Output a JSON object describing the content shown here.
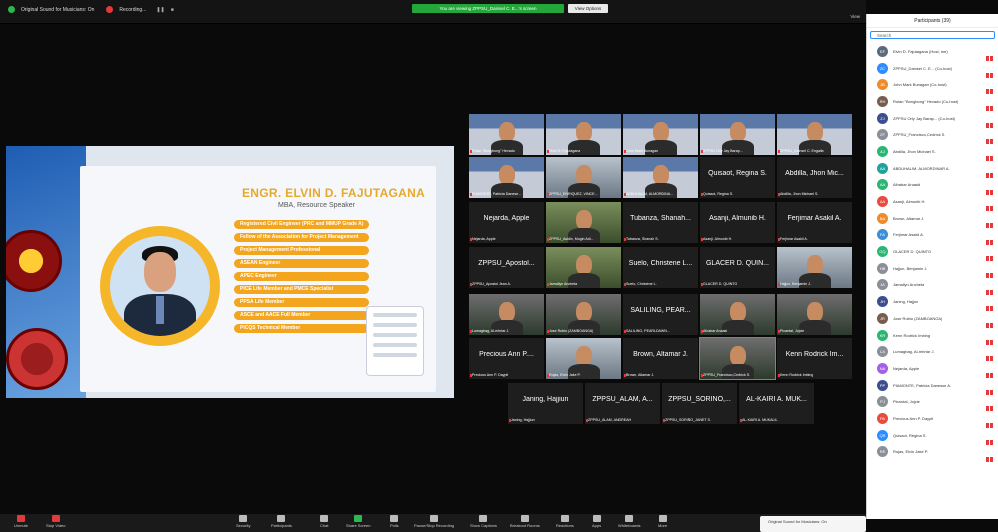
{
  "topbar": {
    "audio_label": "Original Sound for Musicians: On",
    "recording_label": "Recording...",
    "share_notice": "You are viewing ZPPSU_Dainsel C. E...'s screen",
    "view_options": "View Options",
    "view_button": "View"
  },
  "slide": {
    "speaker_name": "ENGR. ELVIN D. FAJUTAGANA",
    "speaker_sub": "MBA, Resource Speaker",
    "credentials": [
      "Registered Civil Engineer (PRC and MMUP Grade A)",
      "Fellow of the Association for Project Management",
      "Project Management Professional",
      "ASEAN Engineer",
      "APEC Engineer",
      "PICE Life Member and PMCE Specialist",
      "PPSA Life Member",
      "ASCE and AACE Full Member",
      "PICQS Technical Member"
    ]
  },
  "tiles": [
    {
      "big": "",
      "small": "Rolan \"Bongbong\" Hevado",
      "style": "cam"
    },
    {
      "big": "",
      "small": "Elvin D. Fajutagana",
      "style": "cam"
    },
    {
      "big": "",
      "small": "John Mark Bunagan",
      "style": "cam"
    },
    {
      "big": "",
      "small": "ZPPSU Orly Jay Barap...",
      "style": "cam"
    },
    {
      "big": "",
      "small": "ZPPSU_Dainsel C. Engalla",
      "style": "cam"
    },
    {
      "big": "",
      "small": "PIAMONTE, Patricia Danese...",
      "style": "cam"
    },
    {
      "big": "",
      "small": "ZPPSU_ENRIQUEZ, VINCE...",
      "style": "cam4"
    },
    {
      "big": "",
      "small": "ABDUHALIM, ALMORDINA...",
      "style": "cam"
    },
    {
      "big": "Quisaot, Regina S.",
      "small": "Quisaot, Regina S.",
      "style": ""
    },
    {
      "big": "Abdilla, Jhon Mic...",
      "small": "Abdilla, Jhon Michael S.",
      "style": ""
    },
    {
      "big": "Nejarda, Apple",
      "small": "Nejarda, Apple",
      "style": ""
    },
    {
      "big": "",
      "small": "ZPPSU_Asidin, Mugin Adi...",
      "style": "cam3"
    },
    {
      "big": "Tubanza, Shanah...",
      "small": "Tubanza, Shanah S.",
      "style": ""
    },
    {
      "big": "Asanji, Almunib H.",
      "small": "Asanji, Almunib H.",
      "style": ""
    },
    {
      "big": "Ferjimar Asakil A.",
      "small": "Ferjimar Asakil A.",
      "style": ""
    },
    {
      "big": "ZPPSU_Apostol...",
      "small": "ZPPSU_Apostol Jean A.",
      "style": ""
    },
    {
      "big": "",
      "small": "Jamailyn Ancheta",
      "style": "cam3"
    },
    {
      "big": "Suelo, Christene L...",
      "small": "Suelo, Christene L.",
      "style": ""
    },
    {
      "big": "GLACER D. QUIN...",
      "small": "GLACER D. QUINTO",
      "style": ""
    },
    {
      "big": "",
      "small": "Hajjun, Benjamin J.",
      "style": "cam4"
    },
    {
      "big": "",
      "small": "Lumagbag, Al-mhrtar J.",
      "style": "cam2"
    },
    {
      "big": "",
      "small": "Jose Rubio (ZAMBOANGA)",
      "style": "cam2"
    },
    {
      "big": "SALILING, PEAR...",
      "small": "SALILING, PEARLDAWN...",
      "style": ""
    },
    {
      "big": "",
      "small": "Alhabar Anaaid",
      "style": "cam2"
    },
    {
      "big": "",
      "small": "Picardal, Jojcie",
      "style": "cam2"
    },
    {
      "big": "Precious Ann P....",
      "small": "Precious Ann P. Daypit",
      "style": ""
    },
    {
      "big": "",
      "small": "Rojas, Elvin Jake P.",
      "style": "cam4"
    },
    {
      "big": "Brown, Altamar J.",
      "small": "Brown, Altamar J.",
      "style": ""
    },
    {
      "big": "",
      "small": "ZPPSU_Francisco,Cedrick S.",
      "style": "cam2"
    },
    {
      "big": "Kenn Rodrick Im...",
      "small": "Kenn Rodrick Imbing",
      "style": ""
    },
    {
      "big": "Janing, Hajjiun",
      "small": "Janing, Hajjiun",
      "style": ""
    },
    {
      "big": "ZPPSU_ALAM, A...",
      "small": "ZPPSU_ALAM, ANDREAH",
      "style": ""
    },
    {
      "big": "ZPPSU_SORIÑO,...",
      "small": "ZPPSU_SORIÑO_JANET S.",
      "style": ""
    },
    {
      "big": "AL-KAIRI A. MUK...",
      "small": "AL-KAIRI A. MUKALIL",
      "style": ""
    }
  ],
  "participants": {
    "title": "Participants (39)",
    "search_placeholder": "Search",
    "list": [
      {
        "initials": "EF",
        "name": "Elvin D. Fajutagana (Host, me)",
        "color": "#5a6b7a"
      },
      {
        "initials": "ZC",
        "name": "ZPPSU_Dainsel C. E... (Co-host)",
        "color": "#2d8cff"
      },
      {
        "initials": "JB",
        "name": "John Mark Bunagan (Co-host)",
        "color": "#f08b2c"
      },
      {
        "initials": "RH",
        "name": "Rolan \"Bongbong\" Hevado (Co-host)",
        "color": "#7a5c4e"
      },
      {
        "initials": "ZJ",
        "name": "ZPPSU Orly Jay Barap... (Co-host)",
        "color": "#3b4e8f"
      },
      {
        "initials": "ZF",
        "name": "ZPPSU_Francisco,Cedrick S.",
        "color": "#8a8f98"
      },
      {
        "initials": "AJ",
        "name": "Abdilla, Jhon Michael S.",
        "color": "#2bb673"
      },
      {
        "initials": "AA",
        "name": "ABDUHALIM, ALMORDINAR A.",
        "color": "#20a39e"
      },
      {
        "initials": "AA",
        "name": "Alhabar Anaaid",
        "color": "#2bb673"
      },
      {
        "initials": "AA",
        "name": "Asanji, Almunib H.",
        "color": "#e74c3c"
      },
      {
        "initials": "BA",
        "name": "Brown, Altamar J.",
        "color": "#f08b2c"
      },
      {
        "initials": "FA",
        "name": "Ferjimar Asakil A.",
        "color": "#3b8fd9"
      },
      {
        "initials": "GQ",
        "name": "GLACER D. QUINTO",
        "color": "#2bb673"
      },
      {
        "initials": "HB",
        "name": "Hajjun, Benjamin J.",
        "color": "#8a8f98"
      },
      {
        "initials": "JA",
        "name": "Jamailyn Ancheta",
        "color": "#8a8f98"
      },
      {
        "initials": "JH",
        "name": "Janing, Hajjun",
        "color": "#3b4e8f"
      },
      {
        "initials": "JR",
        "name": "Jose Rubio (ZAMBOANGA)",
        "color": "#7a5c4e"
      },
      {
        "initials": "KR",
        "name": "Kenn Rodrick Imbing",
        "color": "#2bb673"
      },
      {
        "initials": "LA",
        "name": "Lumagbag, Al-mhrtar J.",
        "color": "#8a8f98"
      },
      {
        "initials": "NA",
        "name": "Nejarda, Apple",
        "color": "#a55eea"
      },
      {
        "initials": "PP",
        "name": "PIAMONTE, Patricia Danesse A.",
        "color": "#3b4e8f"
      },
      {
        "initials": "PJ",
        "name": "Picardal, Jojcie",
        "color": "#8a8f98"
      },
      {
        "initials": "PA",
        "name": "Precious Ann P. Daypit",
        "color": "#e74c3c"
      },
      {
        "initials": "QR",
        "name": "Quisaot, Regina S.",
        "color": "#2d8cff"
      },
      {
        "initials": "RE",
        "name": "Rojas, Elvin Jake P.",
        "color": "#8a8f98"
      }
    ]
  },
  "toolbar": {
    "unmute": "Unmute",
    "stop_video": "Stop Video",
    "security": "Security",
    "participants": "Participants",
    "participants_count": "39",
    "chat": "Chat",
    "share_screen": "Share Screen",
    "polls": "Polls",
    "pause_recording": "Pause/Stop Recording",
    "captions": "Show Captions",
    "breakout": "Breakout Rooms",
    "reactions": "Reactions",
    "apps": "Apps",
    "whiteboards": "Whiteboards",
    "more": "More"
  },
  "end_box": {
    "label": "Original Sound for Musicians: On"
  }
}
